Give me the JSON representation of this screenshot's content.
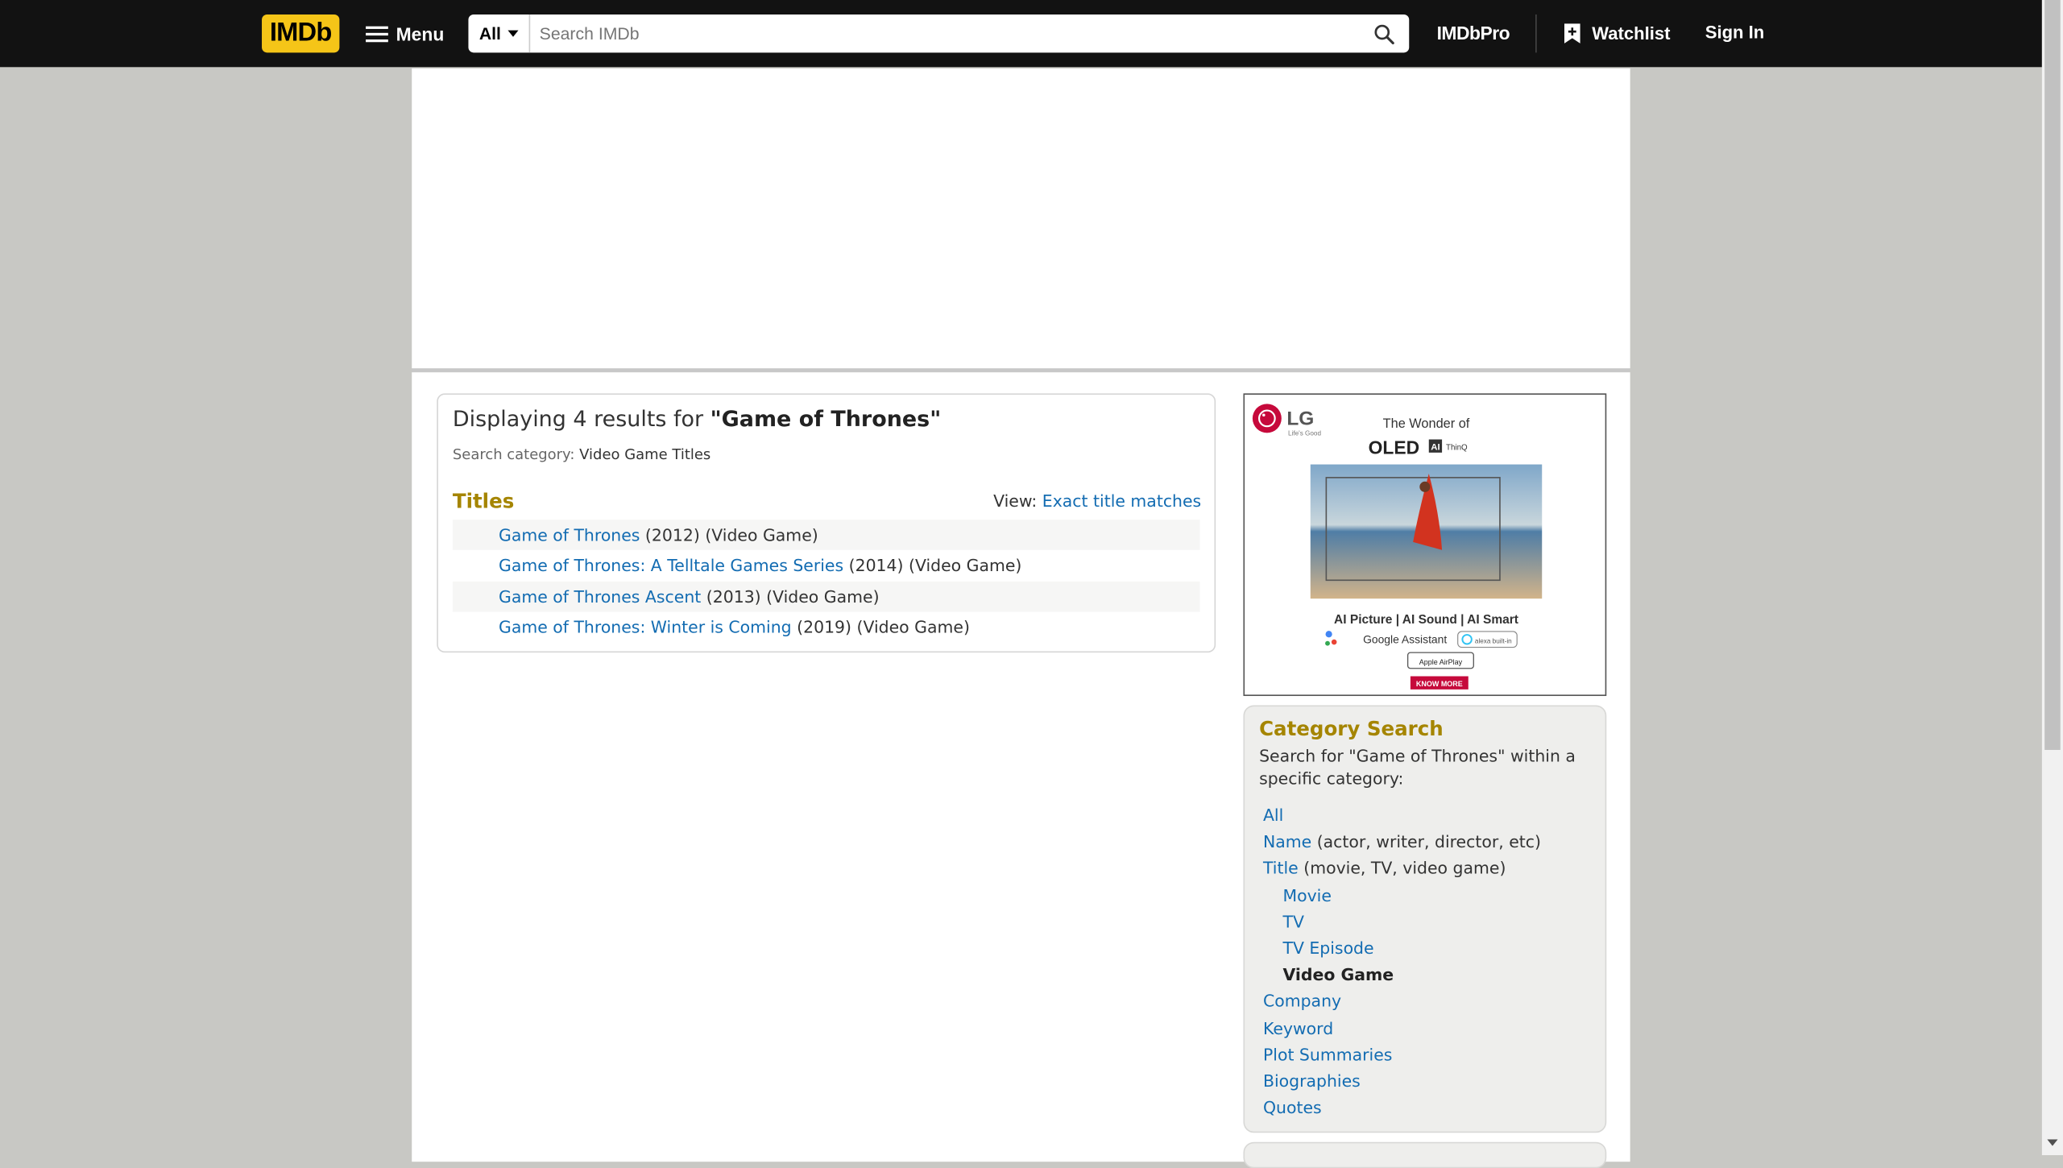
{
  "header": {
    "logo": "IMDb",
    "menu_label": "Menu",
    "search_category": "All",
    "search_placeholder": "Search IMDb",
    "pro_label": "IMDbPro",
    "watchlist_label": "Watchlist",
    "signin_label": "Sign In"
  },
  "results": {
    "heading_prefix": "Displaying 4 results for ",
    "query": "\"Game of Thrones\"",
    "category_label": "Search category: ",
    "category_value": "Video Game Titles",
    "section_title": "Titles",
    "view_label": "View: ",
    "view_link": "Exact title matches",
    "items": [
      {
        "title": "Game of Thrones",
        "meta": " (2012) (Video Game)"
      },
      {
        "title": "Game of Thrones: A Telltale Games Series",
        "meta": " (2014) (Video Game)"
      },
      {
        "title": "Game of Thrones Ascent",
        "meta": " (2013) (Video Game)"
      },
      {
        "title": "Game of Thrones: Winter is Coming",
        "meta": " (2019) (Video Game)"
      }
    ]
  },
  "ad": {
    "brand": "LG",
    "tagline": "Life's Good",
    "headline": "The Wonder of",
    "product": "OLED",
    "product_badge": "AI",
    "product_suffix": "ThinQ",
    "features": "AI Picture  |  AI Sound  |  AI Smart",
    "assistant": "Google Assistant",
    "alexa": "alexa built-in",
    "airplay": "Apple AirPlay",
    "cta": "KNOW MORE"
  },
  "category_search": {
    "title": "Category Search",
    "description": "Search for \"Game of Thrones\" within a specific category:",
    "all": "All",
    "name": "Name",
    "name_note": " (actor, writer, director, etc)",
    "title_link": "Title",
    "title_note": " (movie, TV, video game)",
    "movie": "Movie",
    "tv": "TV",
    "tv_episode": "TV Episode",
    "video_game": "Video Game",
    "company": "Company",
    "keyword": "Keyword",
    "plot_summaries": "Plot Summaries",
    "biographies": "Biographies",
    "quotes": "Quotes"
  },
  "colors": {
    "topbar": "#121212",
    "logo_yellow": "#f5c518",
    "link_blue": "#136cb2",
    "heading_gold": "#a58500"
  }
}
